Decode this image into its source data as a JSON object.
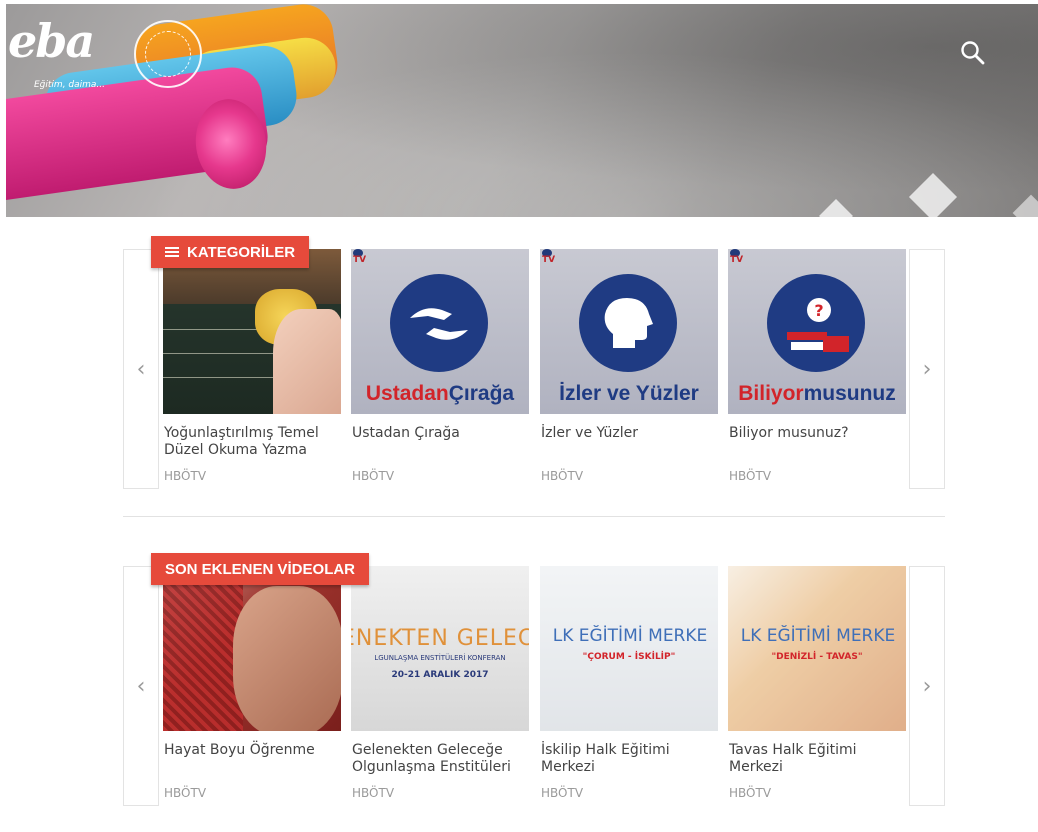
{
  "header": {
    "logo_text": "eba",
    "logo_tagline": "Eğitim, daima...",
    "search_icon": "search-icon",
    "brand_colors": {
      "accent": "#e64a3b",
      "text_muted": "#9a9a9a",
      "border": "#e3e3e3"
    }
  },
  "categories": {
    "section_label": "KATEGORİLER",
    "menu_icon": "hamburger-menu-icon",
    "prev_label": "‹",
    "next_label": "›",
    "items": [
      {
        "title": "Yoğunlaştırılmış Temel Düzel Okuma Yazma",
        "source": "HBÖTV",
        "thumb": "chalkboard-photo"
      },
      {
        "title": "Ustadan Çırağa",
        "source": "HBÖTV",
        "thumb": "hands-emblem",
        "caption_red": "Ustadan",
        "caption_blue": " Çırağa",
        "badge": "TV"
      },
      {
        "title": "İzler ve Yüzler",
        "source": "HBÖTV",
        "thumb": "head-emblem",
        "caption_red": "",
        "caption_blue": "İzler ve Yüzler",
        "badge": "TV"
      },
      {
        "title": "Biliyor musunuz?",
        "source": "HBÖTV",
        "thumb": "question-emblem",
        "caption_red": "Biliyor",
        "caption_blue": " musunuz",
        "badge": "TV"
      }
    ]
  },
  "videos": {
    "section_label": "SON EKLENEN VİDEOLAR",
    "prev_label": "‹",
    "next_label": "›",
    "items": [
      {
        "title": "Hayat Boyu Öğrenme",
        "source": "HBÖTV",
        "thumb": "knitting-photo"
      },
      {
        "title": "Gelenekten Geleceğe Olgunlaşma Enstitüleri",
        "source": "HBÖTV",
        "thumb": "conference-banner",
        "banner_title": "ENEKTEN GELECE",
        "banner_sub": "LGUNLAŞMA ENSTİTÜLERİ KONFERAN",
        "banner_date": "20-21 ARALIK 2017"
      },
      {
        "title": "İskilip Halk Eğitimi Merkezi",
        "source": "HBÖTV",
        "thumb": "building-banner",
        "banner_title": "LK EĞİTİMİ MERKE",
        "banner_sub": "\"ÇORUM - İSKİLİP\""
      },
      {
        "title": "Tavas Halk Eğitimi Merkezi",
        "source": "HBÖTV",
        "thumb": "crafts-banner",
        "banner_title": "LK EĞİTİMİ MERKE",
        "banner_sub": "\"DENİZLİ - TAVAS\""
      }
    ]
  }
}
